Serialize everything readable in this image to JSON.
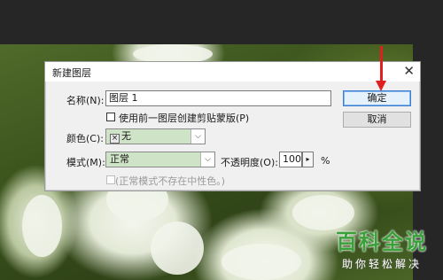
{
  "dialog": {
    "title": "新建图层",
    "close_symbol": "✕",
    "name_label": "名称(N):",
    "name_value": "图层 1",
    "clipping_label": "使用前一图层创建剪贴蒙版(P)",
    "color_label": "颜色(C):",
    "color_value": "无",
    "mode_label": "模式(M):",
    "mode_value": "正常",
    "opacity_label": "不透明度(O):",
    "opacity_value": "100",
    "opacity_unit": "%",
    "neutral_label": "(正常模式不存在中性色。)",
    "ok_label": "确定",
    "cancel_label": "取消"
  },
  "watermark": {
    "main": "百科全说",
    "sub": "助你轻松解决"
  },
  "colors": {
    "annotation_arrow": "#e02020",
    "watermark_green": "#3aa13a",
    "select_bg": "#cfe3c7"
  }
}
